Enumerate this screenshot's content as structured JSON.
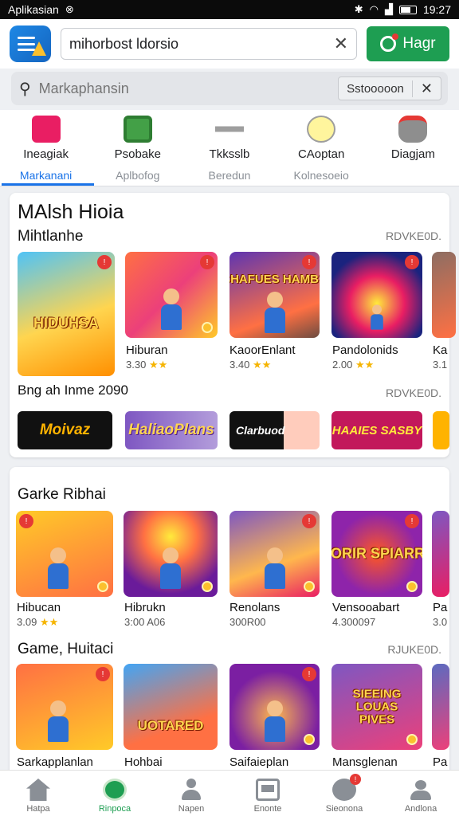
{
  "status_bar": {
    "app_name": "Aplikasian",
    "time": "19:27"
  },
  "top_bar": {
    "url_value": "mihorbost ldorsio",
    "action_label": "Hagr"
  },
  "search": {
    "placeholder": "Markaphansin",
    "chip_label": "Sstooooon"
  },
  "categories": [
    {
      "title": "Ineagiak",
      "subtitle": "Markanani",
      "color": "#e91e63",
      "active": true
    },
    {
      "title": "Psobake",
      "subtitle": "Aplbofog",
      "color": "#43a047"
    },
    {
      "title": "Tkksslb",
      "subtitle": "Beredun",
      "color": "#9e9e9e"
    },
    {
      "title": "CAoptan",
      "subtitle": "Kolnesoeio",
      "color": "#fdd835"
    },
    {
      "title": "Diagjam",
      "subtitle": "",
      "color": "#8e8e8e"
    }
  ],
  "section1": {
    "heading": "MAlsh Hioia",
    "subheading": "Mihtlanhe",
    "more_label": "RDVKE0D.",
    "games": [
      {
        "name": "",
        "rating": "",
        "title_art": "HIDUHSA"
      },
      {
        "name": "Hiburan",
        "rating": "3.30",
        "title_art": ""
      },
      {
        "name": "KaoorEnlant",
        "rating": "3.40",
        "title_art": "SHAFUES HAMBS"
      },
      {
        "name": "Pandolonids",
        "rating": "2.00",
        "title_art": ""
      },
      {
        "name": "Ka",
        "rating": "3.1",
        "title_art": ""
      }
    ],
    "promo_heading": "Bng ah Inme 2090",
    "promo_more": "RDVKE0D.",
    "banners": [
      {
        "label": "Moivaz"
      },
      {
        "label": "HaliaoPlans"
      },
      {
        "label": "Clarbuod"
      },
      {
        "label": "HAAIES SASBY"
      },
      {
        "label": ""
      }
    ]
  },
  "section2": {
    "heading": "Garke Ribhai",
    "games": [
      {
        "name": "Hibucan",
        "rating": "3.09",
        "title_art": ""
      },
      {
        "name": "Hibrukn",
        "rating": "3:00 A06",
        "title_art": ""
      },
      {
        "name": "Renolans",
        "rating": "300R00",
        "title_art": ""
      },
      {
        "name": "Vensooabart",
        "rating": "4.300097",
        "title_art": "GORIR SPIARRS"
      },
      {
        "name": "Pa",
        "rating": "3.0",
        "title_art": ""
      }
    ]
  },
  "section3": {
    "heading": "Game, Huitaci",
    "more_label": "RJUKE0D.",
    "games": [
      {
        "name": "Sarkapplanlan",
        "title_art": ""
      },
      {
        "name": "Hohbai",
        "title_art": "UOTARED"
      },
      {
        "name": "Saifaieplan",
        "title_art": ""
      },
      {
        "name": "Mansglenan",
        "title_art": "SIEEING LOUAS PIVES"
      },
      {
        "name": "Pa",
        "title_art": ""
      }
    ]
  },
  "bottom_nav": [
    {
      "label": "Hatpa"
    },
    {
      "label": "Rinpoca",
      "active": true
    },
    {
      "label": "Napen"
    },
    {
      "label": "Enonte"
    },
    {
      "label": "Sieonona",
      "badge": "!"
    },
    {
      "label": "Andlona"
    }
  ]
}
